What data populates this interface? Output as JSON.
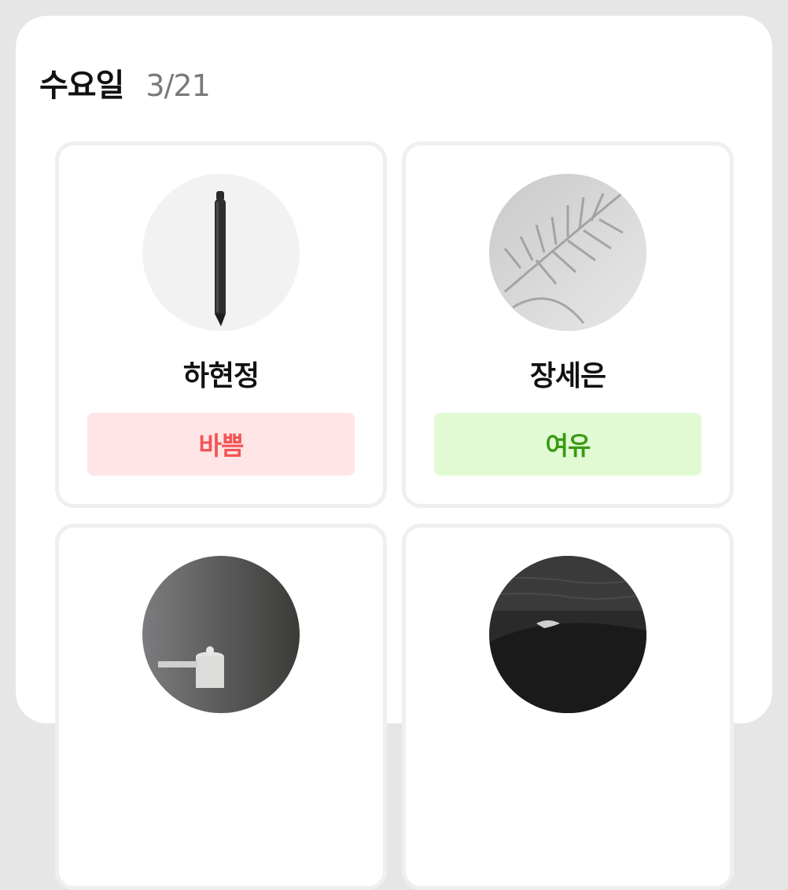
{
  "header": {
    "day_label": "수요일",
    "date_label": "3/21"
  },
  "colors": {
    "busy_bg": "#ffe5e5",
    "busy_text": "#f25555",
    "free_bg": "#e1fad4",
    "free_text": "#3a9a12"
  },
  "people": [
    {
      "name": "하현정",
      "status": "바쁨",
      "status_type": "busy",
      "avatar": "pen-photo"
    },
    {
      "name": "장세은",
      "status": "여유",
      "status_type": "free",
      "avatar": "palm-shadow-photo"
    },
    {
      "name": "",
      "status": "",
      "status_type": "",
      "avatar": "teapot-photo"
    },
    {
      "name": "",
      "status": "",
      "status_type": "",
      "avatar": "ocean-wave-photo"
    }
  ]
}
